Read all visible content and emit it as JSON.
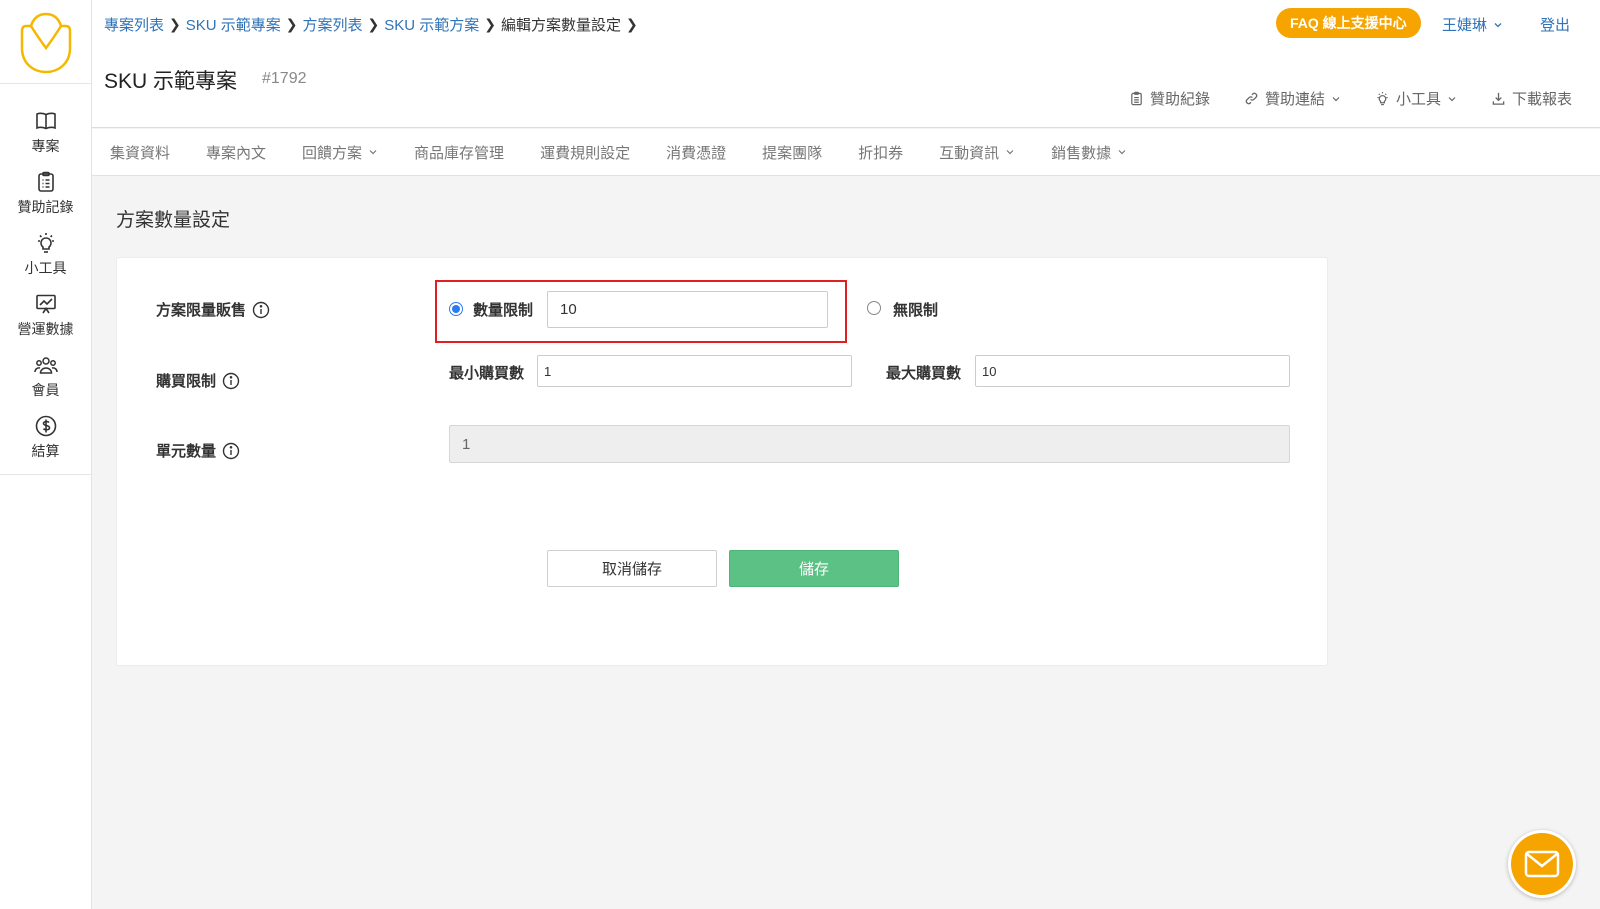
{
  "breadcrumb": {
    "items": [
      {
        "label": "專案列表"
      },
      {
        "label": "SKU 示範專案"
      },
      {
        "label": "方案列表"
      },
      {
        "label": "SKU 示範方案"
      }
    ],
    "current": "編輯方案數量設定"
  },
  "project": {
    "title": "SKU 示範專案",
    "id": "#1792"
  },
  "header": {
    "faq_label": "FAQ 線上支援中心",
    "user_name": "王婕琳",
    "logout_label": "登出"
  },
  "tools": [
    {
      "label": "贊助紀錄",
      "icon": "clipboard-icon"
    },
    {
      "label": "贊助連結",
      "icon": "link-icon"
    },
    {
      "label": "小工具",
      "icon": "lightbulb-icon"
    },
    {
      "label": "下載報表",
      "icon": "download-icon"
    }
  ],
  "sidebar": {
    "items": [
      {
        "label": "專案",
        "icon": "book-icon"
      },
      {
        "label": "贊助記錄",
        "icon": "clipboard-icon"
      },
      {
        "label": "小工具",
        "icon": "lightbulb-icon"
      },
      {
        "label": "營運數據",
        "icon": "chart-icon"
      },
      {
        "label": "會員",
        "icon": "users-icon"
      },
      {
        "label": "結算",
        "icon": "dollar-icon"
      }
    ]
  },
  "tabs": [
    {
      "label": "集資資料"
    },
    {
      "label": "專案內文"
    },
    {
      "label": "回饋方案"
    },
    {
      "label": "商品庫存管理"
    },
    {
      "label": "運費規則設定"
    },
    {
      "label": "消費憑證"
    },
    {
      "label": "提案團隊"
    },
    {
      "label": "折扣券"
    },
    {
      "label": "互動資訊"
    },
    {
      "label": "銷售數據"
    }
  ],
  "page": {
    "title": "方案數量設定"
  },
  "form": {
    "limit_sale": {
      "label": "方案限量販售",
      "option_limited": "數量限制",
      "limited_value": "10",
      "option_unlimited": "無限制",
      "selected": "數量限制"
    },
    "purchase_limit": {
      "label": "購買限制",
      "min_label": "最小購買數",
      "min_value": "1",
      "max_label": "最大購買數",
      "max_value": "10"
    },
    "unit_quantity": {
      "label": "單元數量",
      "value": "1"
    }
  },
  "buttons": {
    "cancel": "取消儲存",
    "save": "儲存"
  },
  "colors": {
    "accent": "#f5a400",
    "link": "#2f73b8",
    "save": "#5cc185",
    "highlight": "#e02020",
    "radio": "#2b7cf0"
  }
}
